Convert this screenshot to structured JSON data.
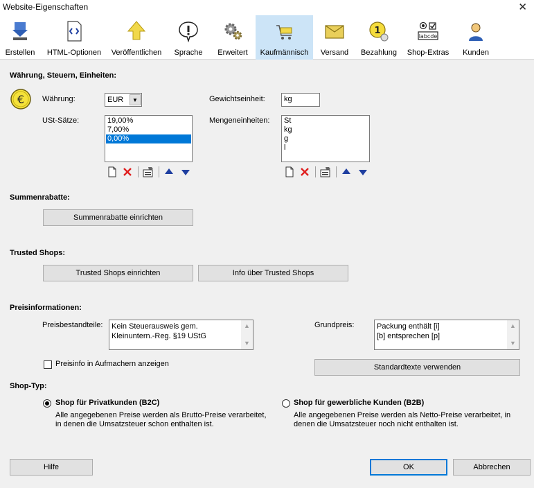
{
  "window": {
    "title": "Website-Eigenschaften",
    "close_glyph": "✕"
  },
  "toolbar": {
    "items": [
      {
        "label": "Erstellen",
        "icon": "create-icon"
      },
      {
        "label": "HTML-Optionen",
        "icon": "html-icon"
      },
      {
        "label": "Veröffentlichen",
        "icon": "publish-icon"
      },
      {
        "label": "Sprache",
        "icon": "language-icon"
      },
      {
        "label": "Erweitert",
        "icon": "gears-icon"
      },
      {
        "label": "Kaufmännisch",
        "icon": "cart-icon",
        "active": true
      },
      {
        "label": "Versand",
        "icon": "package-icon"
      },
      {
        "label": "Bezahlung",
        "icon": "coin-icon"
      },
      {
        "label": "Shop-Extras",
        "icon": "options-icon"
      },
      {
        "label": "Kunden",
        "icon": "customer-icon"
      }
    ]
  },
  "waehrung_section": {
    "heading": "Währung, Steuern, Einheiten:",
    "currency_label": "Währung:",
    "currency_value": "EUR",
    "vat_label": "USt-Sätze:",
    "vat_rates": [
      "19,00%",
      "7,00%",
      "0,00%"
    ],
    "vat_selected": 2,
    "weight_unit_label": "Gewichtseinheit:",
    "weight_unit_value": "kg",
    "quantity_units_label": "Mengeneinheiten:",
    "quantity_units": [
      "St",
      "kg",
      "g",
      "l"
    ]
  },
  "summenrabatte": {
    "heading": "Summenrabatte:",
    "setup_button": "Summenrabatte einrichten"
  },
  "trusted_shops": {
    "heading": "Trusted Shops:",
    "setup_button": "Trusted Shops einrichten",
    "info_button": "Info über Trusted Shops"
  },
  "preisinformationen": {
    "heading": "Preisinformationen:",
    "components_label": "Preisbestandteile:",
    "components_lines": [
      "Kein Steuerausweis gem.",
      "Kleinuntern.-Reg. §19 UStG"
    ],
    "base_price_label": "Grundpreis:",
    "base_price_lines": [
      "Packung enthält [i]",
      "[b] entsprechen [p]"
    ],
    "show_in_teaser_label": "Preisinfo in Aufmachern anzeigen",
    "show_in_teaser_checked": false,
    "standard_texts_button": "Standardtexte verwenden"
  },
  "shop_typ": {
    "heading": "Shop-Typ:",
    "b2c_label": "Shop für Privatkunden (B2C)",
    "b2c_desc_lines": [
      "Alle angegebenen Preise werden als Brutto-Preise verarbeitet,",
      "in denen die Umsatzsteuer schon enthalten ist."
    ],
    "b2b_label": "Shop für gewerbliche Kunden (B2B)",
    "b2b_desc_lines": [
      "Alle angegebenen Preise werden als Netto-Preise verarbeitet, in",
      "denen die Umsatzsteuer noch nicht enthalten ist."
    ],
    "selected": "b2c"
  },
  "footer": {
    "help_button": "Hilfe",
    "ok_button": "OK",
    "cancel_button": "Abbrechen"
  },
  "colors": {
    "accent": "#0078d7",
    "active_tab": "#cce4f7",
    "delete": "#e02020",
    "arrow": "#1f3fa0"
  }
}
